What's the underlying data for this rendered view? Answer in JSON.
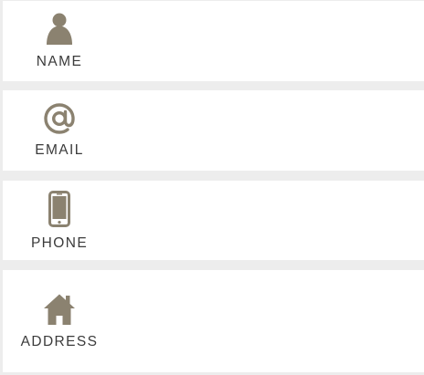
{
  "fields": {
    "name": {
      "label": "NAME",
      "icon": "person-icon",
      "value": ""
    },
    "email": {
      "label": "EMAIL",
      "icon": "at-sign-icon",
      "value": ""
    },
    "phone": {
      "label": "PHONE",
      "icon": "smartphone-icon",
      "value": ""
    },
    "address": {
      "label": "ADDRESS",
      "icon": "house-icon",
      "value": ""
    }
  },
  "colors": {
    "icon": "#8b8270",
    "label": "#3b3b3b",
    "row_background": "#ffffff",
    "separator": "#ededed"
  }
}
